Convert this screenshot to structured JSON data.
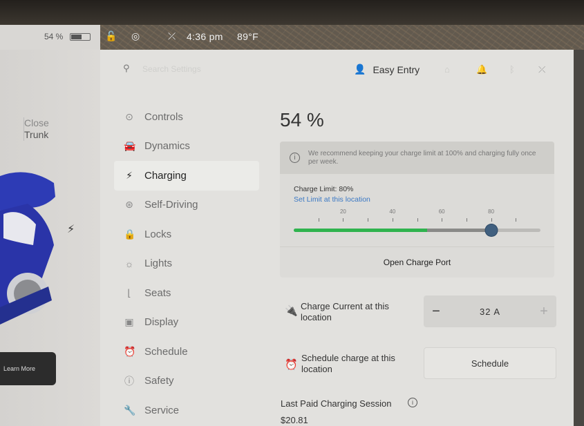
{
  "status_bar": {
    "battery_percent": "54 %",
    "battery_level": 0.54,
    "time": "4:36 pm",
    "temperature": "89°F"
  },
  "car_panel": {
    "trunk_label_top": "Close",
    "trunk_label_bottom": "Trunk",
    "learn_more": "Learn More"
  },
  "header": {
    "search_placeholder": "Search Settings",
    "profile_name": "Easy Entry"
  },
  "nav": [
    {
      "label": "Controls",
      "icon": "toggle-icon"
    },
    {
      "label": "Dynamics",
      "icon": "car-icon"
    },
    {
      "label": "Charging",
      "icon": "bolt-icon",
      "active": true
    },
    {
      "label": "Self-Driving",
      "icon": "steering-wheel-icon"
    },
    {
      "label": "Locks",
      "icon": "lock-icon"
    },
    {
      "label": "Lights",
      "icon": "sun-icon"
    },
    {
      "label": "Seats",
      "icon": "seat-icon"
    },
    {
      "label": "Display",
      "icon": "display-icon"
    },
    {
      "label": "Schedule",
      "icon": "alarm-icon"
    },
    {
      "label": "Safety",
      "icon": "warning-icon"
    },
    {
      "label": "Service",
      "icon": "wrench-icon"
    }
  ],
  "charging": {
    "battery": "54 %",
    "notice": "We recommend keeping your charge limit at 100% and charging fully once per week.",
    "limit_label": "Charge Limit: 80%",
    "limit_link": "Set Limit at this location",
    "slider_ticks": [
      "20",
      "40",
      "60",
      "80"
    ],
    "slider_value": 80,
    "current_battery": 54,
    "open_port": "Open Charge Port",
    "current_label_line1": "Charge Current at this",
    "current_label_line2": "location",
    "current_value": "32 A",
    "minus": "−",
    "plus": "+",
    "schedule_label_line1": "Schedule charge at this",
    "schedule_label_line2": "location",
    "schedule_button": "Schedule",
    "last_paid_label": "Last Paid Charging Session",
    "last_paid_amount": "$20.81"
  },
  "colors": {
    "accent_green": "#2fb34e",
    "link_blue": "#3a78c4",
    "knob": "#41607f"
  }
}
